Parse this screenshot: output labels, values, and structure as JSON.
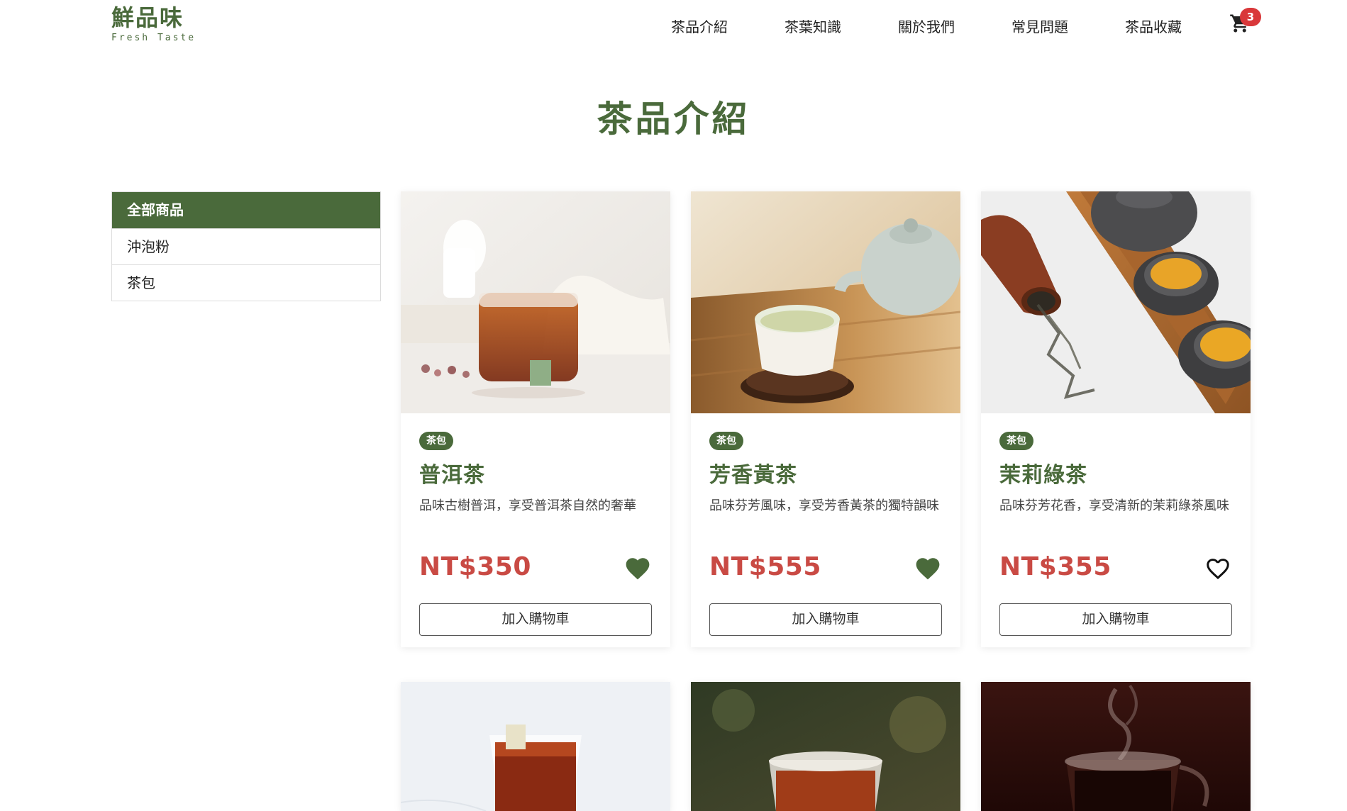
{
  "brand": {
    "name_cn": "鮮品味",
    "name_en": "Fresh Taste"
  },
  "nav": {
    "items": [
      "茶品介紹",
      "茶葉知識",
      "關於我們",
      "常見問題",
      "茶品收藏"
    ],
    "cart_icon": "cart-icon",
    "cart_count": "3"
  },
  "page_title": "茶品介紹",
  "sidebar": {
    "items": [
      {
        "label": "全部商品",
        "active": true
      },
      {
        "label": "沖泡粉",
        "active": false
      },
      {
        "label": "茶包",
        "active": false
      }
    ]
  },
  "products": [
    {
      "tag": "茶包",
      "name": "普洱茶",
      "desc": "品味古樹普洱，享受普洱茶自然的奢華",
      "price": "NT$350",
      "favorited": true,
      "button": "加入購物車"
    },
    {
      "tag": "茶包",
      "name": "芳香黃茶",
      "desc": "品味芬芳風味，享受芳香黃茶的獨特韻味",
      "price": "NT$555",
      "favorited": true,
      "button": "加入購物車"
    },
    {
      "tag": "茶包",
      "name": "茉莉綠茶",
      "desc": "品味芬芳花香，享受清新的茉莉綠茶風味",
      "price": "NT$355",
      "favorited": false,
      "button": "加入購物車"
    }
  ],
  "colors": {
    "brand_green": "#4a6a3b",
    "price_red": "#c94a44",
    "badge_red": "#d9383a"
  }
}
